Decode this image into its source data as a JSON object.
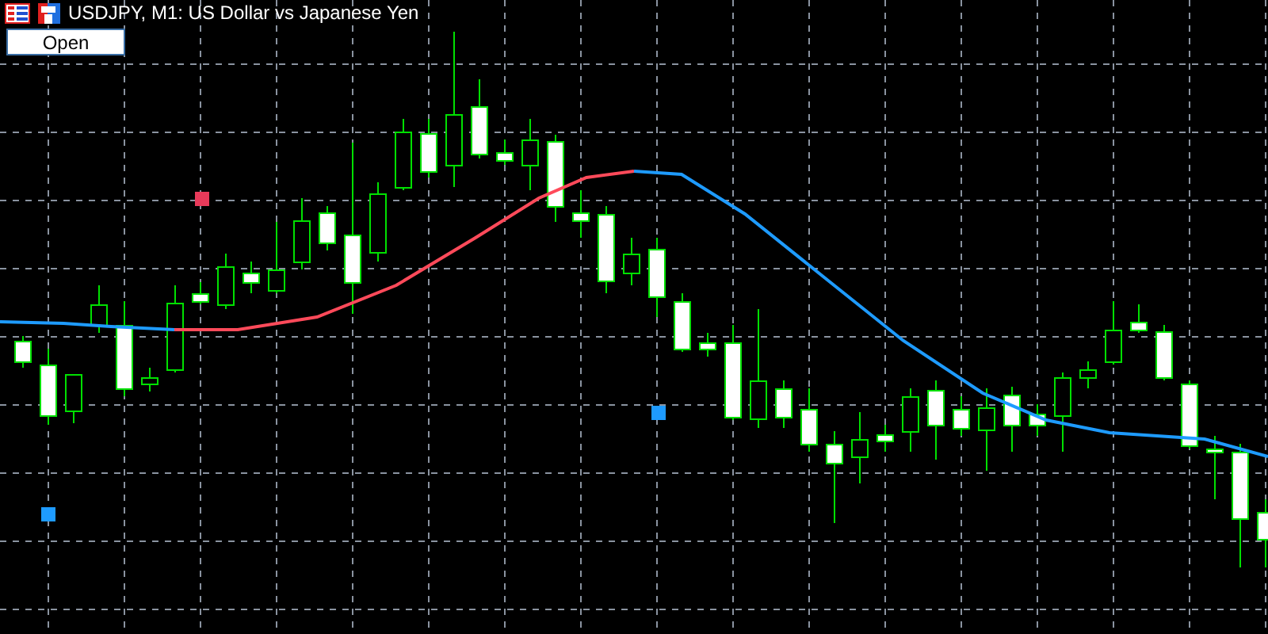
{
  "window": {
    "title": "USDJPY, M1:  US Dollar vs Japanese Yen"
  },
  "buttons": [
    {
      "label": "Open"
    }
  ]
}
